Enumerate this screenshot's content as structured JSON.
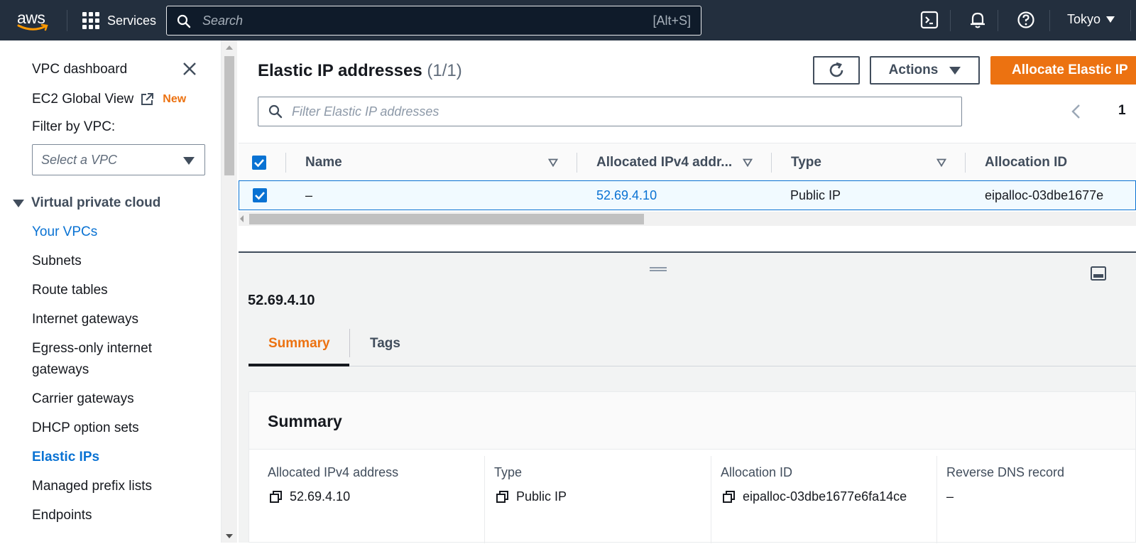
{
  "nav": {
    "logo": "aws",
    "services": "Services",
    "search_placeholder": "Search",
    "search_shortcut": "[Alt+S]",
    "region": "Tokyo"
  },
  "sidebar": {
    "dashboard": "VPC dashboard",
    "global_view": "EC2 Global View",
    "new_badge": "New",
    "filter_label": "Filter by VPC:",
    "filter_placeholder": "Select a VPC",
    "section": "Virtual private cloud",
    "items": [
      "Your VPCs",
      "Subnets",
      "Route tables",
      "Internet gateways",
      "Egress-only internet",
      "gateways",
      "Carrier gateways",
      "DHCP option sets",
      "Elastic IPs",
      "Managed prefix lists",
      "Endpoints"
    ]
  },
  "main": {
    "title": "Elastic IP addresses",
    "count": "(1/1)",
    "actions_label": "Actions",
    "allocate_label": "Allocate Elastic IP",
    "filter_placeholder": "Filter Elastic IP addresses",
    "page": "1",
    "columns": [
      "Name",
      "Allocated IPv4 addr...",
      "Type",
      "Allocation ID"
    ],
    "rows": [
      {
        "name": "–",
        "ip": "52.69.4.10",
        "type": "Public IP",
        "allocation_id": "eipalloc-03dbe1677e"
      }
    ]
  },
  "detail": {
    "title": "52.69.4.10",
    "tabs": [
      "Summary",
      "Tags"
    ],
    "card_title": "Summary",
    "fields": [
      {
        "label": "Allocated IPv4 address",
        "value": "52.69.4.10",
        "copy": true
      },
      {
        "label": "Type",
        "value": "Public IP",
        "copy": true
      },
      {
        "label": "Allocation ID",
        "value": "eipalloc-03dbe1677e6fa14ce",
        "copy": true
      },
      {
        "label": "Reverse DNS record",
        "value": "–",
        "copy": false
      }
    ]
  },
  "colors": {
    "nav_bg": "#232f3e",
    "primary": "#ec7211",
    "link": "#0972d3",
    "selected_row": "#f1faff"
  }
}
